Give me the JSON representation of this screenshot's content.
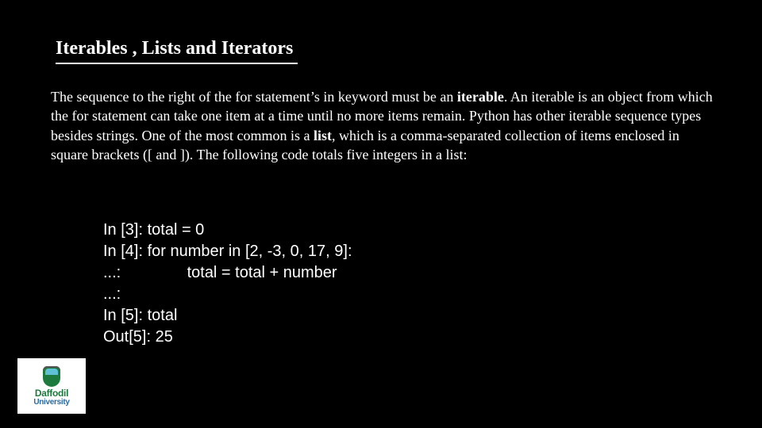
{
  "title": "Iterables , Lists and Iterators",
  "paragraph": {
    "p1": "The sequence to the right of the for statement’s in keyword must be an ",
    "kw1": "iterable",
    "p2": ". An iterable is an object from which the for statement can take one item at a time until no more items remain. Python has other iterable sequence types besides strings. One of the most common is a ",
    "kw2": "list",
    "p3": ", which is a comma-separated collection of items enclosed in square brackets ([ and ]). The following code totals five integers in a list:"
  },
  "code_lines": [
    "In [3]: total = 0",
    "In [4]: for number in [2, -3, 0, 17, 9]:",
    "...:               total = total + number",
    "...:",
    "In [5]: total",
    "Out[5]: 25"
  ],
  "logo": {
    "line1": "Daffodil",
    "line2": "University"
  }
}
